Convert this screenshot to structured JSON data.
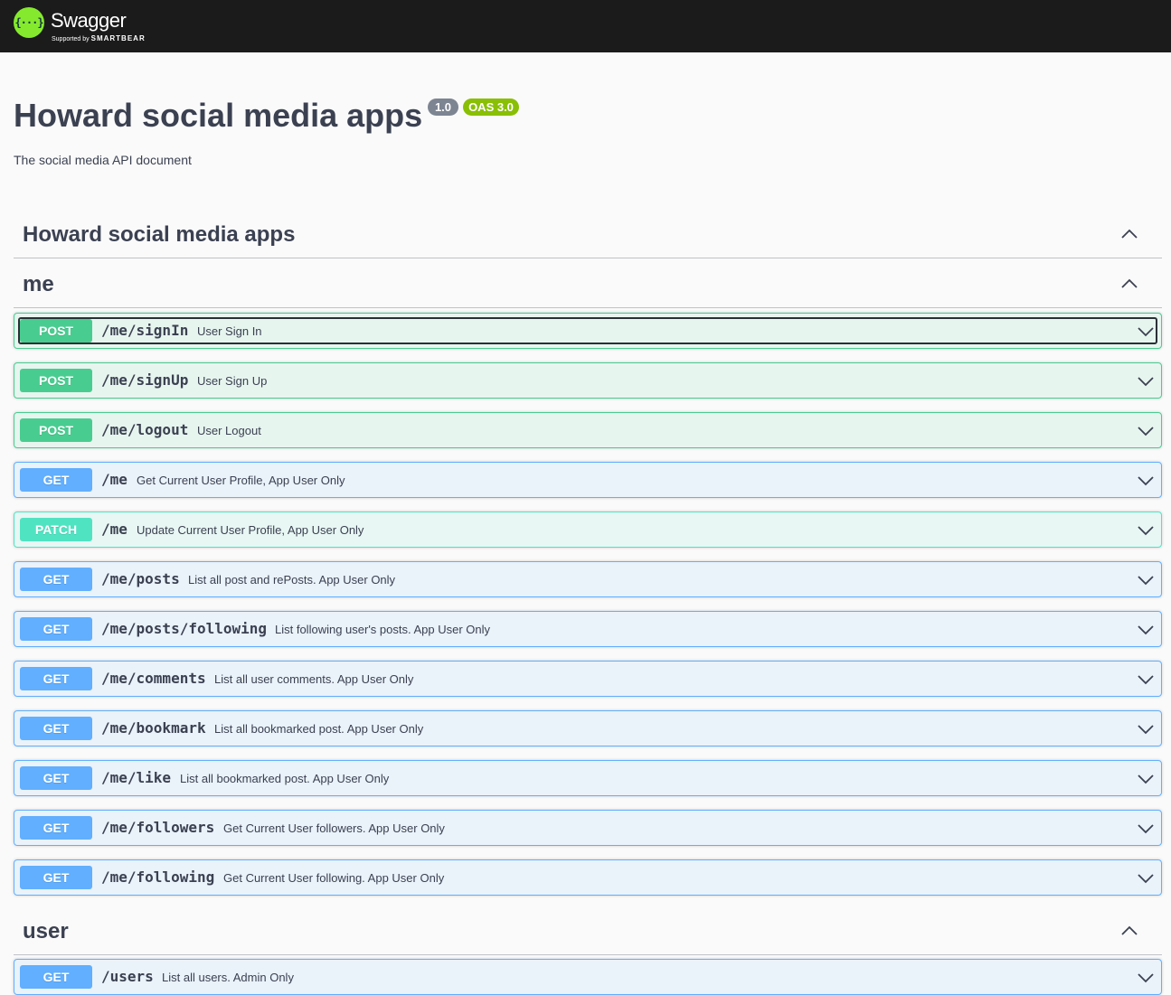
{
  "topbar": {
    "logo_glyph": "{···}",
    "brand": "Swagger",
    "supported_by": "Supported by",
    "smartbear": "SMARTBEAR"
  },
  "info": {
    "title": "Howard social media apps",
    "version": "1.0",
    "oas": "OAS 3.0",
    "description": "The social media API document"
  },
  "colors": {
    "post": "#49cc90",
    "get": "#61affe",
    "patch": "#50e3c2",
    "topbar": "#1b1b1b",
    "oas_badge": "#89bf04",
    "version_badge": "#7d8492"
  },
  "tags": [
    {
      "name": "Howard social media apps"
    },
    {
      "name": "me"
    },
    {
      "name": "user"
    }
  ],
  "operations": [
    {
      "method": "POST",
      "path": "/me/signIn",
      "summary": "User Sign In"
    },
    {
      "method": "POST",
      "path": "/me/signUp",
      "summary": "User Sign Up"
    },
    {
      "method": "POST",
      "path": "/me/logout",
      "summary": "User Logout"
    },
    {
      "method": "GET",
      "path": "/me",
      "summary": "Get Current User Profile, App User Only"
    },
    {
      "method": "PATCH",
      "path": "/me",
      "summary": "Update Current User Profile, App User Only"
    },
    {
      "method": "GET",
      "path": "/me/posts",
      "summary": "List all post and rePosts. App User Only"
    },
    {
      "method": "GET",
      "path": "/me/posts/following",
      "summary": "List following user's posts. App User Only"
    },
    {
      "method": "GET",
      "path": "/me/comments",
      "summary": "List all user comments. App User Only"
    },
    {
      "method": "GET",
      "path": "/me/bookmark",
      "summary": "List all bookmarked post. App User Only"
    },
    {
      "method": "GET",
      "path": "/me/like",
      "summary": "List all bookmarked post. App User Only"
    },
    {
      "method": "GET",
      "path": "/me/followers",
      "summary": "Get Current User followers. App User Only"
    },
    {
      "method": "GET",
      "path": "/me/following",
      "summary": "Get Current User following. App User Only"
    },
    {
      "method": "GET",
      "path": "/users",
      "summary": "List all users. Admin Only"
    }
  ]
}
